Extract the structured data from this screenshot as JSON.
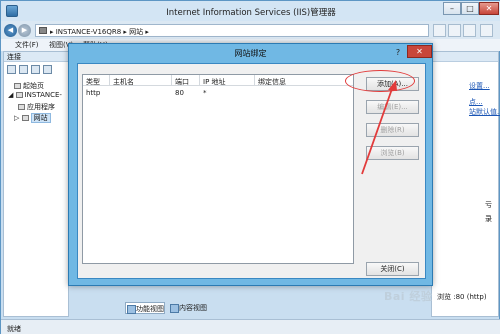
{
  "window": {
    "title": "Internet Information Services (IIS)管理器",
    "controls": {
      "minimize": "–",
      "maximize": "□",
      "close": "✕"
    }
  },
  "address": {
    "path": "▸ INSTANCE-V16QR8 ▸ 网站 ▸"
  },
  "menu": {
    "file": "文件(F)",
    "view": "视图(V)",
    "help": "帮助(H)"
  },
  "connections": {
    "header": "连接",
    "tree": [
      {
        "label": "起始页"
      },
      {
        "label": "INSTANCE-"
      },
      {
        "label": "应用程序"
      },
      {
        "label": "网站"
      }
    ]
  },
  "actions": {
    "links": [
      "设置...",
      "点...",
      "站默认值..."
    ],
    "texts": [
      "亏",
      "录",
      "浏览 :80 (http)"
    ]
  },
  "bottom_tabs": {
    "features": "功能视图",
    "content": "内容视图"
  },
  "status": {
    "text": "就绪"
  },
  "dialog": {
    "title": "网站绑定",
    "help": "?",
    "close": "✕",
    "columns": {
      "type": "类型",
      "hostname": "主机名",
      "port": "端口",
      "ip": "IP 地址",
      "binding": "绑定信息"
    },
    "rows": [
      {
        "type": "http",
        "hostname": "",
        "port": "80",
        "ip": "*",
        "binding": ""
      }
    ],
    "buttons": {
      "add": "添加(A)...",
      "edit": "编辑(E)...",
      "remove": "删除(R)",
      "browse": "浏览(B)",
      "close": "关闭(C)"
    }
  },
  "watermark": "Bai 经验",
  "colors": {
    "dialog_frame": "#70b8e4",
    "annotation": "#e23b3b",
    "close_button": "#c8463b"
  }
}
